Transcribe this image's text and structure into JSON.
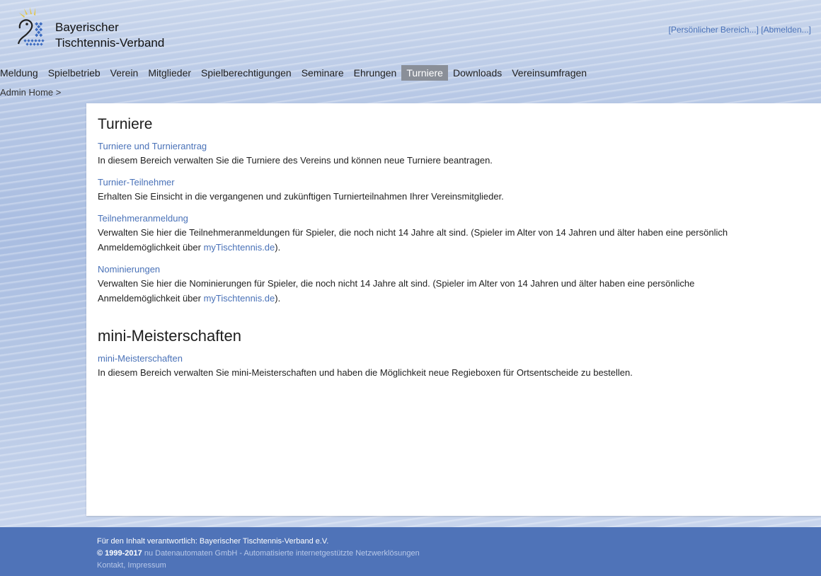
{
  "brand": {
    "line1": "Bayerischer",
    "line2": "Tischtennis-Verband"
  },
  "top_links": {
    "personal": "[Persönlicher Bereich...]",
    "logout": "[Abmelden...]"
  },
  "nav": {
    "items": [
      {
        "label": "Meldung"
      },
      {
        "label": "Spielbetrieb"
      },
      {
        "label": "Verein"
      },
      {
        "label": "Mitglieder"
      },
      {
        "label": "Spielberechtigungen"
      },
      {
        "label": "Seminare"
      },
      {
        "label": "Ehrungen"
      },
      {
        "label": "Turniere",
        "active": true
      },
      {
        "label": "Downloads"
      },
      {
        "label": "Vereinsumfragen"
      }
    ]
  },
  "breadcrumb": {
    "home": "Admin Home",
    "sep": ">"
  },
  "sections": [
    {
      "title": "Turniere",
      "items": [
        {
          "link": "Turniere und Turnierantrag",
          "desc": "In diesem Bereich verwalten Sie die Turniere des Vereins und können neue Turniere beantragen."
        },
        {
          "link": "Turnier-Teilnehmer",
          "desc": "Erhalten Sie Einsicht in die vergangenen und zukünftigen Turnierteilnahmen Ihrer Vereinsmitglieder."
        },
        {
          "link": "Teilnehmeranmeldung",
          "desc_before": "Verwalten Sie hier die Teilnehmeranmeldungen für Spieler, die noch nicht 14 Jahre alt sind. (Spieler im Alter von 14 Jahren und älter haben eine persönlich",
          "desc_line2": "Anmeldemöglichkeit über",
          "inline_link": "myTischtennis.de",
          "desc_after": ")."
        },
        {
          "link": "Nominierungen",
          "desc_before": "Verwalten Sie hier die Nominierungen für Spieler, die noch nicht 14 Jahre alt sind. (Spieler im Alter von 14 Jahren und älter haben eine persönliche",
          "desc_line2": "Anmeldemöglichkeit über",
          "inline_link": "myTischtennis.de",
          "desc_after": ")."
        }
      ]
    },
    {
      "title": "mini-Meisterschaften",
      "items": [
        {
          "link": "mini-Meisterschaften",
          "desc": "In diesem Bereich verwalten Sie mini-Meisterschaften und haben die Möglichkeit neue Regieboxen für Ortsentscheide zu bestellen."
        }
      ]
    }
  ],
  "footer": {
    "line1": "Für den Inhalt verantwortlich: Bayerischer Tischtennis-Verband e.V.",
    "copyright": "© 1999-2017",
    "company": "nu Datenautomaten GmbH - Automatisierte internetgestützte Netzwerklösungen",
    "contact": "Kontakt, Impressum"
  },
  "colors": {
    "accent": "#4a72b8",
    "footer_bg": "#4f73b8",
    "nav_active_bg": "#8a8f98"
  }
}
